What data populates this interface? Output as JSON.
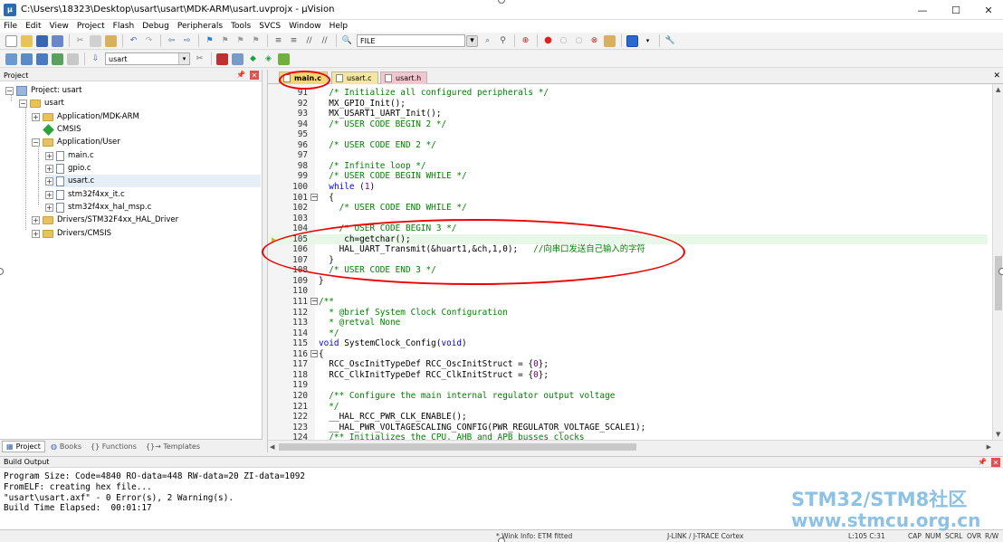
{
  "window": {
    "title": "C:\\Users\\18323\\Desktop\\usart\\usart\\MDK-ARM\\usart.uvprojx - µVision",
    "controls": {
      "minimize": "—",
      "maximize": "☐",
      "close": "✕"
    }
  },
  "menu": [
    "File",
    "Edit",
    "View",
    "Project",
    "Flash",
    "Debug",
    "Peripherals",
    "Tools",
    "SVCS",
    "Window",
    "Help"
  ],
  "toolbar1": {
    "find_combo": "FILE"
  },
  "toolbar2": {
    "target_combo": "usart"
  },
  "project_panel": {
    "title": "Project",
    "tree": [
      {
        "label": "Project: usart",
        "icon": "project-icon"
      },
      {
        "label": "usart",
        "icon": "folder-icon"
      },
      {
        "label": "Application/MDK-ARM",
        "icon": "folder-icon"
      },
      {
        "label": "CMSIS",
        "icon": "diamond-icon"
      },
      {
        "label": "Application/User",
        "icon": "folder-icon"
      },
      {
        "label": "main.c",
        "icon": "file-icon"
      },
      {
        "label": "gpio.c",
        "icon": "file-icon"
      },
      {
        "label": "usart.c",
        "icon": "file-icon"
      },
      {
        "label": "stm32f4xx_it.c",
        "icon": "file-icon"
      },
      {
        "label": "stm32f4xx_hal_msp.c",
        "icon": "file-icon"
      },
      {
        "label": "Drivers/STM32F4xx_HAL_Driver",
        "icon": "folder-icon"
      },
      {
        "label": "Drivers/CMSIS",
        "icon": "folder-icon"
      }
    ],
    "tabs": [
      "Project",
      "Books",
      "{} Functions",
      "{}→ Templates"
    ]
  },
  "editor": {
    "tabs": [
      {
        "label": "main.c",
        "color": "#f5d76e"
      },
      {
        "label": "usart.c",
        "color": "#f5e6a0"
      },
      {
        "label": "usart.h",
        "color": "#f3c6cf"
      }
    ],
    "lines": [
      {
        "n": "91",
        "code": "  /* Initialize all configured peripherals */",
        "cls": "cm"
      },
      {
        "n": "92",
        "code": "  MX_GPIO_Init();",
        "cls": "nm"
      },
      {
        "n": "93",
        "code": "  MX_USART1_UART_Init();",
        "cls": "nm"
      },
      {
        "n": "94",
        "code": "  /* USER CODE BEGIN 2 */",
        "cls": "cm"
      },
      {
        "n": "95",
        "code": "",
        "cls": "nm"
      },
      {
        "n": "96",
        "code": "  /* USER CODE END 2 */",
        "cls": "cm"
      },
      {
        "n": "97",
        "code": "",
        "cls": "nm"
      },
      {
        "n": "98",
        "code": "  /* Infinite loop */",
        "cls": "cm"
      },
      {
        "n": "99",
        "code": "  /* USER CODE BEGIN WHILE */",
        "cls": "cm"
      },
      {
        "n": "100",
        "code": "  while (1)",
        "cls": "kw"
      },
      {
        "n": "101",
        "code": "  {",
        "cls": "nm"
      },
      {
        "n": "102",
        "code": "    /* USER CODE END WHILE */",
        "cls": "cm"
      },
      {
        "n": "103",
        "code": "",
        "cls": "nm"
      },
      {
        "n": "104",
        "code": "    /* USER CODE BEGIN 3 */",
        "cls": "cm"
      },
      {
        "n": "105",
        "code": "     ch=getchar();",
        "cls": "nm"
      },
      {
        "n": "106",
        "code": "    HAL_UART_Transmit(&huart1,&ch,1,0);   //向串口发送自己输入的字符",
        "cls": "nm"
      },
      {
        "n": "107",
        "code": "  }",
        "cls": "nm"
      },
      {
        "n": "108",
        "code": "  /* USER CODE END 3 */",
        "cls": "cm"
      },
      {
        "n": "109",
        "code": "}",
        "cls": "nm"
      },
      {
        "n": "110",
        "code": "",
        "cls": "nm"
      },
      {
        "n": "111",
        "code": "/**",
        "cls": "cm"
      },
      {
        "n": "112",
        "code": "  * @brief System Clock Configuration",
        "cls": "cm"
      },
      {
        "n": "113",
        "code": "  * @retval None",
        "cls": "cm"
      },
      {
        "n": "114",
        "code": "  */",
        "cls": "cm"
      },
      {
        "n": "115",
        "code": "void SystemClock_Config(void)",
        "cls": "nm"
      },
      {
        "n": "116",
        "code": "{",
        "cls": "nm"
      },
      {
        "n": "117",
        "code": "  RCC_OscInitTypeDef RCC_OscInitStruct = {0};",
        "cls": "nm"
      },
      {
        "n": "118",
        "code": "  RCC_ClkInitTypeDef RCC_ClkInitStruct = {0};",
        "cls": "nm"
      },
      {
        "n": "119",
        "code": "",
        "cls": "nm"
      },
      {
        "n": "120",
        "code": "  /** Configure the main internal regulator output voltage",
        "cls": "cm"
      },
      {
        "n": "121",
        "code": "  */",
        "cls": "cm"
      },
      {
        "n": "122",
        "code": "  __HAL_RCC_PWR_CLK_ENABLE();",
        "cls": "nm"
      },
      {
        "n": "123",
        "code": "  __HAL_PWR_VOLTAGESCALING_CONFIG(PWR_REGULATOR_VOLTAGE_SCALE1);",
        "cls": "nm"
      },
      {
        "n": "124",
        "code": "  /** Initializes the CPU, AHB and APB busses clocks",
        "cls": "cm"
      }
    ]
  },
  "build_output": {
    "title": "Build Output",
    "lines": [
      "Program Size: Code=4840 RO-data=448 RW-data=20 ZI-data=1092",
      "FromELF: creating hex file...",
      "\"usart\\usart.axf\" - 0 Error(s), 2 Warning(s).",
      "Build Time Elapsed:  00:01:17"
    ]
  },
  "status_bar": {
    "link_info": "* Wink Info: ETM fitted",
    "debugger": "J-LINK / J-TRACE Cortex",
    "position": "L:105 C:31",
    "indicators": [
      "CAP",
      "NUM",
      "SCRL",
      "OVR",
      "R/W"
    ]
  },
  "watermark": {
    "line1": "STM32/STM8社区",
    "line2": "www.stmcu.org.cn"
  }
}
